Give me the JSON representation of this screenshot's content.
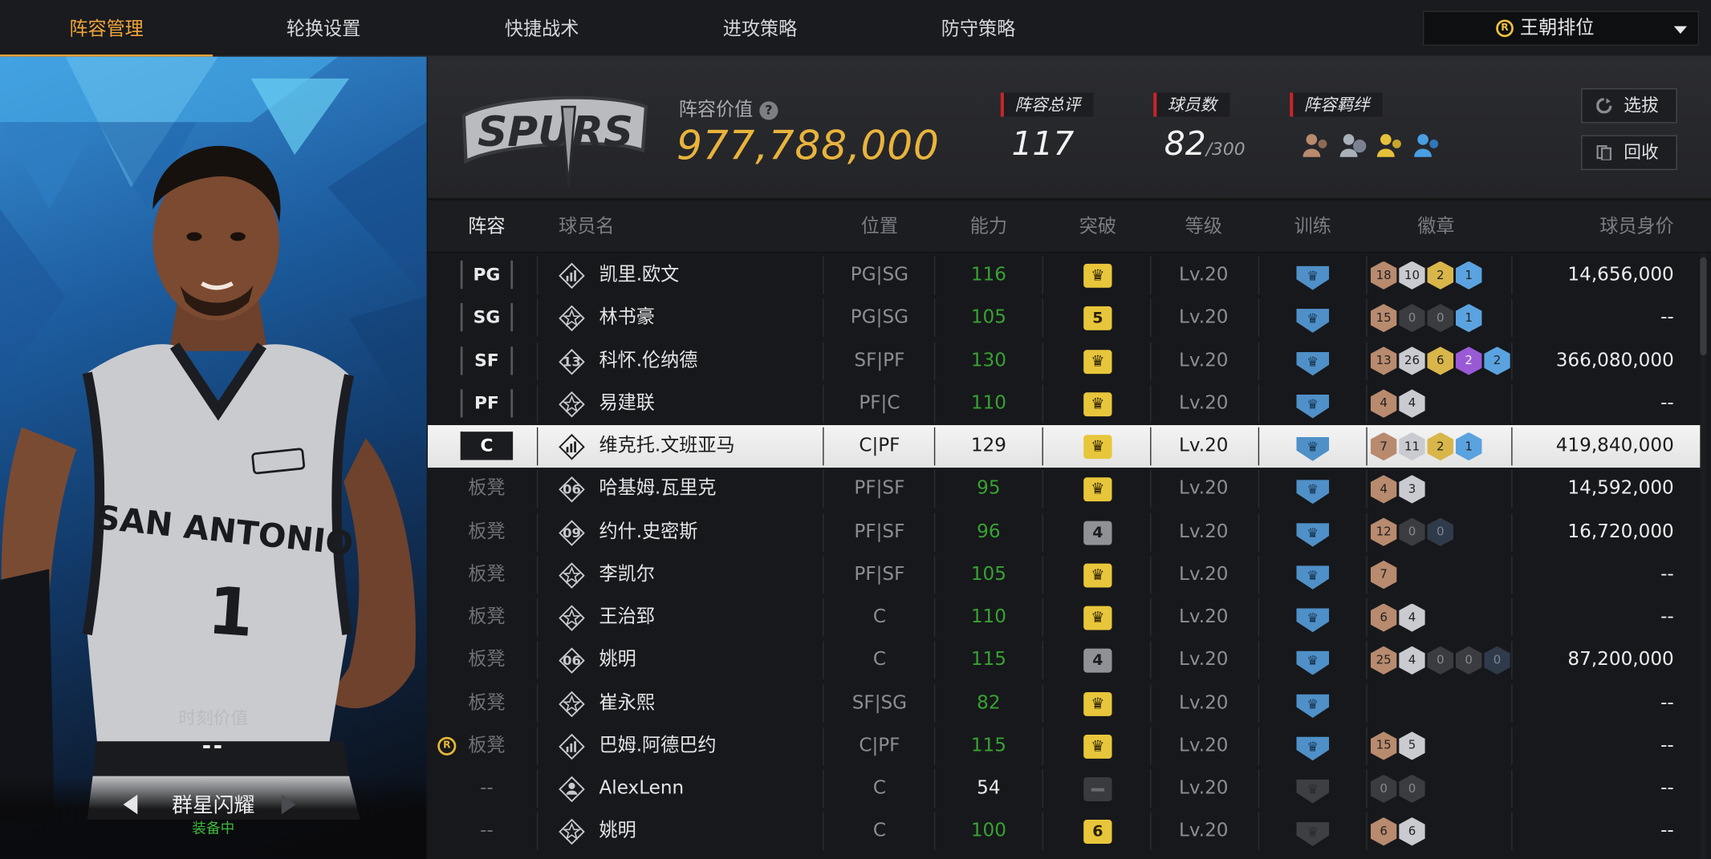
{
  "tabs": [
    "阵容管理",
    "轮换设置",
    "快捷战术",
    "进攻策略",
    "防守策略"
  ],
  "mode_select": {
    "label": "王朝排位",
    "icon": "clock-icon"
  },
  "card": {
    "moment_label": "时刻价值",
    "moment_value": "--",
    "name": "群星闪耀",
    "status": "装备中",
    "jersey_team": "SAN ANTONIO",
    "jersey_number": "1"
  },
  "header": {
    "team_logo": "SPURS",
    "value_label": "阵容价值",
    "value": "977,788,000",
    "stats": [
      {
        "label": "阵容总评",
        "value": "117",
        "sub": ""
      },
      {
        "label": "球员数",
        "value": "82",
        "sub": "/300"
      },
      {
        "label": "阵容羁绊",
        "value": "",
        "sub": ""
      }
    ],
    "buttons": [
      {
        "label": "选拔",
        "icon": "refresh-icon"
      },
      {
        "label": "回收",
        "icon": "recycle-icon"
      }
    ]
  },
  "columns": [
    "阵容",
    "球员名",
    "位置",
    "能力",
    "突破",
    "等级",
    "训练",
    "徽章",
    "球员身价"
  ],
  "rows": [
    {
      "slot": "PG",
      "starter": true,
      "icon": "bars-icon",
      "name": "凯里.欧文",
      "pos": "PG|SG",
      "ability": "116",
      "ab_color": "g",
      "breakthrough": "crown",
      "level": "Lv.20",
      "training": "crown",
      "badges": [
        [
          "br",
          "18"
        ],
        [
          "sv",
          "10"
        ],
        [
          "gd",
          "2"
        ],
        [
          "bl",
          "1"
        ]
      ],
      "value": "14,656,000"
    },
    {
      "slot": "SG",
      "starter": true,
      "icon": "star-icon",
      "name": "林书豪",
      "pos": "PG|SG",
      "ability": "105",
      "ab_color": "g",
      "breakthrough": "5",
      "level": "Lv.20",
      "training": "crown",
      "badges": [
        [
          "br",
          "15"
        ],
        [
          "nn",
          "0"
        ],
        [
          "nn",
          "0"
        ],
        [
          "bl",
          "1"
        ]
      ],
      "value": "--"
    },
    {
      "slot": "SF",
      "starter": true,
      "icon": "number-icon",
      "icon_num": "13",
      "name": "科怀.伦纳德",
      "pos": "SF|PF",
      "ability": "130",
      "ab_color": "g",
      "breakthrough": "crown",
      "level": "Lv.20",
      "training": "crown",
      "badges": [
        [
          "br",
          "13"
        ],
        [
          "sv",
          "26"
        ],
        [
          "gd",
          "6"
        ],
        [
          "pu",
          "2"
        ],
        [
          "bl",
          "2"
        ]
      ],
      "value": "366,080,000"
    },
    {
      "slot": "PF",
      "starter": true,
      "icon": "star-icon",
      "name": "易建联",
      "pos": "PF|C",
      "ability": "110",
      "ab_color": "g",
      "breakthrough": "crown",
      "level": "Lv.20",
      "training": "crown",
      "badges": [
        [
          "br",
          "4"
        ],
        [
          "sv",
          "4"
        ]
      ],
      "value": "--"
    },
    {
      "slot": "C",
      "starter": true,
      "selected": true,
      "icon": "bars-icon",
      "name": "维克托.文班亚马",
      "pos": "C|PF",
      "ability": "129",
      "ab_color": "w",
      "breakthrough": "crown",
      "level": "Lv.20",
      "training": "crown",
      "badges": [
        [
          "br",
          "7"
        ],
        [
          "sv",
          "11"
        ],
        [
          "gd",
          "2"
        ],
        [
          "bl",
          "1"
        ]
      ],
      "value": "419,840,000"
    },
    {
      "slot": "板凳",
      "starter": false,
      "icon": "number-icon",
      "icon_num": "06",
      "name": "哈基姆.瓦里克",
      "pos": "PF|SF",
      "ability": "95",
      "ab_color": "g",
      "breakthrough": "crown",
      "level": "Lv.20",
      "training": "crown",
      "badges": [
        [
          "br",
          "4"
        ],
        [
          "sv",
          "3"
        ]
      ],
      "value": "14,592,000"
    },
    {
      "slot": "板凳",
      "starter": false,
      "icon": "number-icon",
      "icon_num": "09",
      "name": "约什.史密斯",
      "pos": "PF|SF",
      "ability": "96",
      "ab_color": "g",
      "breakthrough": "4",
      "level": "Lv.20",
      "training": "crown",
      "badges": [
        [
          "br",
          "12"
        ],
        [
          "nn",
          "0"
        ],
        [
          "nb",
          "0"
        ]
      ],
      "value": "16,720,000"
    },
    {
      "slot": "板凳",
      "starter": false,
      "icon": "star-icon",
      "name": "李凯尔",
      "pos": "PF|SF",
      "ability": "105",
      "ab_color": "g",
      "breakthrough": "crown",
      "level": "Lv.20",
      "training": "crown",
      "badges": [
        [
          "br",
          "7"
        ]
      ],
      "value": "--"
    },
    {
      "slot": "板凳",
      "starter": false,
      "icon": "star-icon",
      "name": "王治郅",
      "pos": "C",
      "ability": "110",
      "ab_color": "g",
      "breakthrough": "crown",
      "level": "Lv.20",
      "training": "crown",
      "badges": [
        [
          "br",
          "6"
        ],
        [
          "sv",
          "4"
        ]
      ],
      "value": "--"
    },
    {
      "slot": "板凳",
      "starter": false,
      "icon": "number-icon",
      "icon_num": "06",
      "name": "姚明",
      "pos": "C",
      "ability": "115",
      "ab_color": "g",
      "breakthrough": "4",
      "level": "Lv.20",
      "training": "crown",
      "badges": [
        [
          "br",
          "25"
        ],
        [
          "sv",
          "4"
        ],
        [
          "nn",
          "0"
        ],
        [
          "nn",
          "0"
        ],
        [
          "nb",
          "0"
        ]
      ],
      "value": "87,200,000"
    },
    {
      "slot": "板凳",
      "starter": false,
      "icon": "star-icon",
      "name": "崔永熙",
      "pos": "SF|SG",
      "ability": "82",
      "ab_color": "g",
      "breakthrough": "crown",
      "level": "Lv.20",
      "training": "crown",
      "badges": [],
      "value": "--"
    },
    {
      "slot": "板凳",
      "starter": false,
      "clock": true,
      "icon": "bars-icon",
      "name": "巴姆.阿德巴约",
      "pos": "C|PF",
      "ability": "115",
      "ab_color": "g",
      "breakthrough": "crown",
      "level": "Lv.20",
      "training": "crown",
      "badges": [
        [
          "br",
          "15"
        ],
        [
          "sv",
          "5"
        ]
      ],
      "value": "--"
    },
    {
      "slot": "--",
      "starter": false,
      "icon": "person-icon",
      "name": "AlexLenn",
      "pos": "C",
      "ability": "54",
      "ab_color": "w",
      "breakthrough": "dark",
      "level": "Lv.20",
      "training": "dark",
      "badges": [
        [
          "nn",
          "0"
        ],
        [
          "nn",
          "0"
        ]
      ],
      "value": "--"
    },
    {
      "slot": "--",
      "starter": false,
      "icon": "star-icon",
      "name": "姚明",
      "pos": "C",
      "ability": "100",
      "ab_color": "g",
      "breakthrough": "6",
      "level": "Lv.20",
      "training": "dark",
      "badges": [
        [
          "br",
          "6"
        ],
        [
          "sv",
          "6"
        ]
      ],
      "value": "--"
    }
  ]
}
